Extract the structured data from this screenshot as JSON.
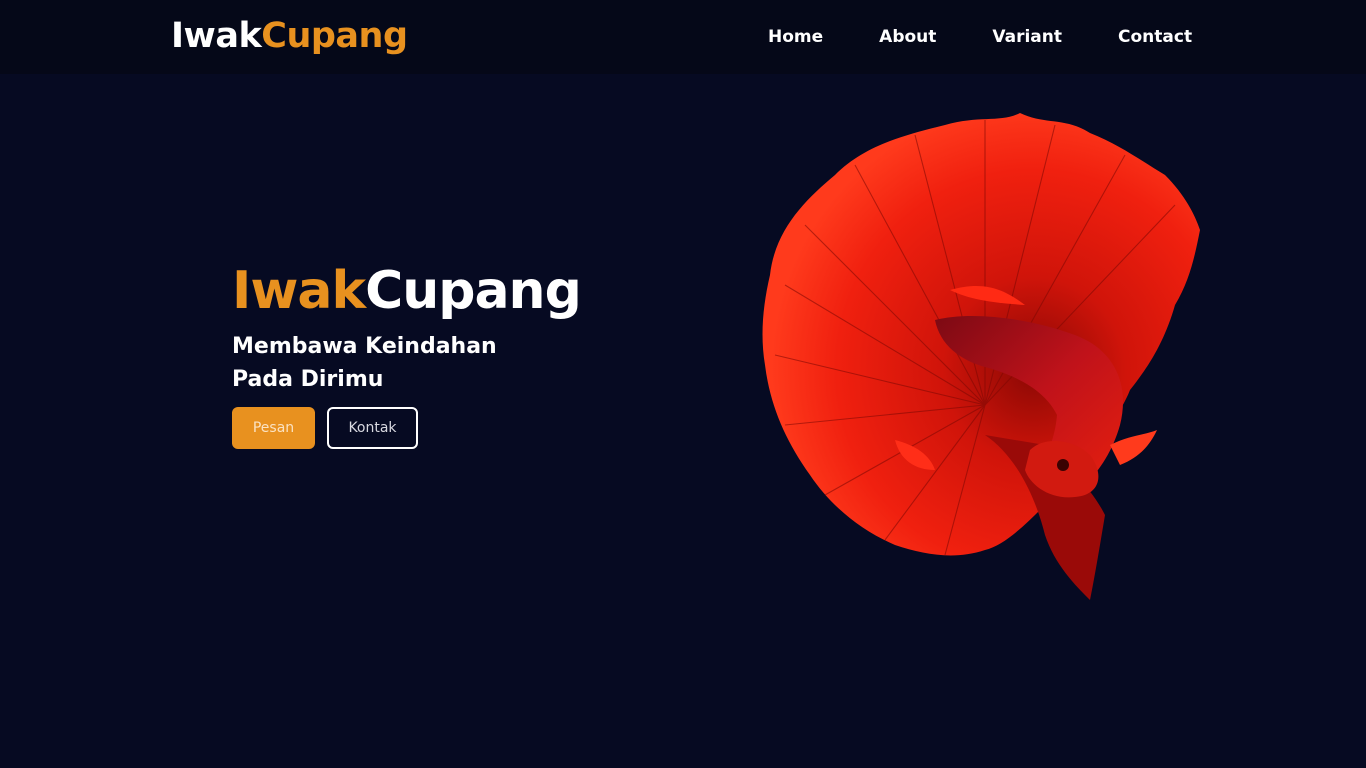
{
  "navbar": {
    "brand": {
      "part1": "Iwak",
      "part2": "Cupang"
    },
    "links": [
      {
        "label": "Home"
      },
      {
        "label": "About"
      },
      {
        "label": "Variant"
      },
      {
        "label": "Contact"
      }
    ]
  },
  "hero": {
    "title": {
      "part1": "Iwak",
      "part2": "Cupang"
    },
    "tagline_line1": "Membawa Keindahan",
    "tagline_line2": "Pada Dirimu",
    "primary_button": "Pesan",
    "secondary_button": "Kontak",
    "image": "red-betta-fish-image"
  },
  "colors": {
    "background": "#060a22",
    "navbar": "#050818",
    "accent": "#e8911f",
    "text": "#ffffff",
    "fish_red": "#e8150c"
  }
}
